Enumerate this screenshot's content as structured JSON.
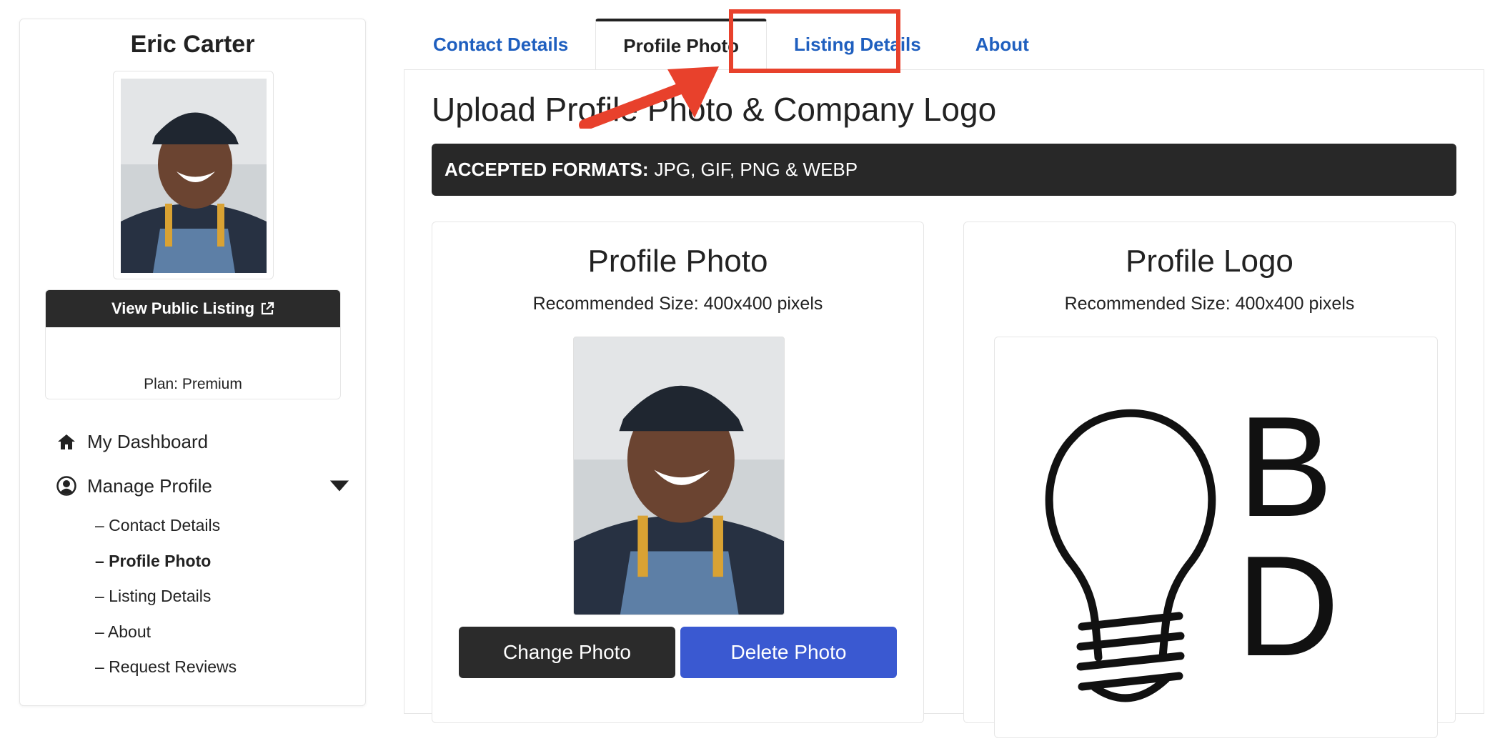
{
  "sidebar": {
    "user_name": "Eric Carter",
    "view_listing_label": "View Public Listing",
    "plan": "Plan: Premium",
    "nav": {
      "dashboard": "My Dashboard",
      "manage_profile": "Manage Profile",
      "sub_items": [
        {
          "label": "– Contact Details"
        },
        {
          "label": "– Profile Photo"
        },
        {
          "label": "– Listing Details"
        },
        {
          "label": "– About"
        },
        {
          "label": "– Request Reviews"
        }
      ],
      "active_sub_item": "– Profile Photo"
    }
  },
  "tabs": [
    {
      "label": "Contact Details"
    },
    {
      "label": "Profile Photo"
    },
    {
      "label": "Listing Details"
    },
    {
      "label": "About"
    }
  ],
  "active_tab": "Profile Photo",
  "highlighted_tab": "Listing Details",
  "main": {
    "title": "Upload Profile Photo & Company Logo",
    "formats_label": "ACCEPTED FORMATS:",
    "formats_value": "JPG, GIF, PNG & WEBP",
    "photo_card": {
      "title": "Profile Photo",
      "subtitle": "Recommended Size: 400x400 pixels",
      "change_button": "Change Photo",
      "delete_button": "Delete Photo"
    },
    "logo_card": {
      "title": "Profile Logo",
      "subtitle": "Recommended Size: 400x400 pixels",
      "logo_letters": [
        "B",
        "D"
      ]
    }
  },
  "icons": {
    "dashboard": "home-icon",
    "manage_profile": "user-circle-icon",
    "external_link": "external-link-icon",
    "caret": "caret-down-icon"
  },
  "colors": {
    "tab_link": "#1f5fbf",
    "dark_button": "#2b2b2b",
    "delete_button": "#3a59d1",
    "highlight": "#e8412c"
  }
}
